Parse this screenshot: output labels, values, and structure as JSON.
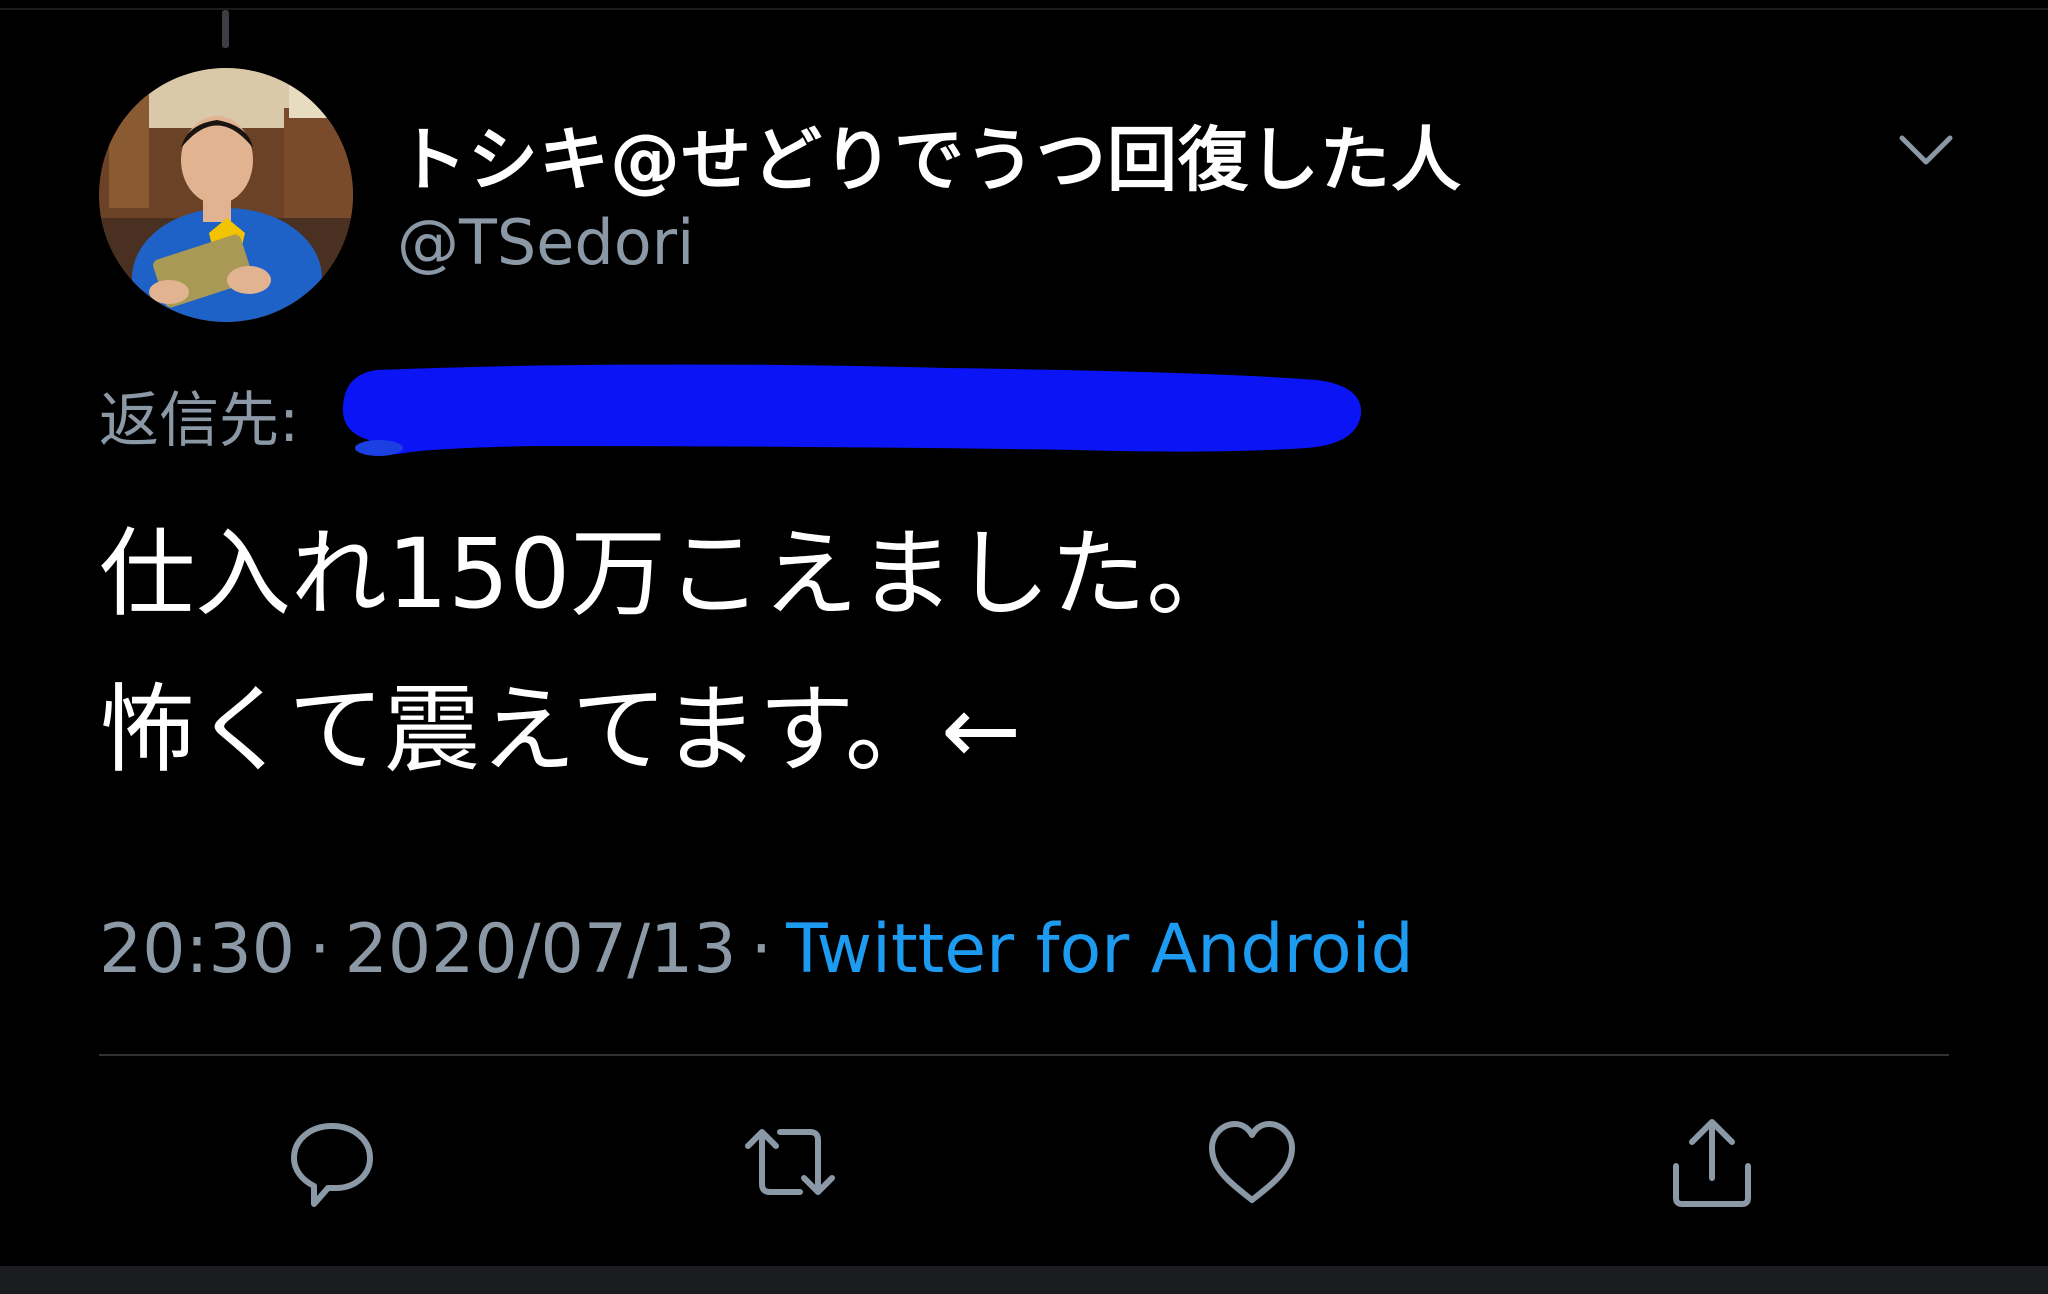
{
  "tweet": {
    "author": {
      "display_name": "トシキ@せどりでうつ回復した人",
      "handle": "@TSedori"
    },
    "reply_to_label": "返信先:",
    "body_lines": [
      "仕入れ150万こえました。",
      "怖くて震えてます。←"
    ],
    "time": "20:30",
    "date": "2020/07/13",
    "separator": "·",
    "source": "Twitter for Android"
  },
  "icons": {
    "caret": "chevron-down-icon",
    "reply": "reply-icon",
    "retweet": "retweet-icon",
    "like": "heart-icon",
    "share": "share-icon"
  },
  "colors": {
    "background": "#000000",
    "text_primary": "#ffffff",
    "text_secondary": "#8b98a5",
    "accent": "#1d9bf0",
    "redaction": "#0a14f5",
    "divider": "#2f3336"
  }
}
